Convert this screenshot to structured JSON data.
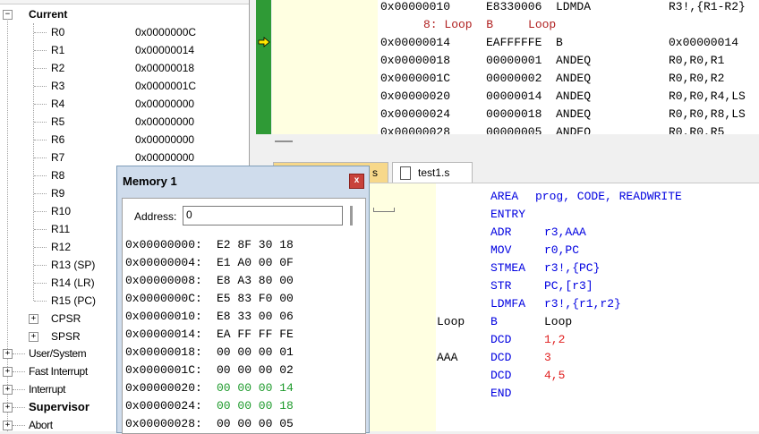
{
  "registers": {
    "group_label": "Current",
    "rows": [
      {
        "name": "R0",
        "value": "0x0000000C"
      },
      {
        "name": "R1",
        "value": "0x00000014"
      },
      {
        "name": "R2",
        "value": "0x00000018"
      },
      {
        "name": "R3",
        "value": "0x0000001C"
      },
      {
        "name": "R4",
        "value": "0x00000000"
      },
      {
        "name": "R5",
        "value": "0x00000000"
      },
      {
        "name": "R6",
        "value": "0x00000000"
      },
      {
        "name": "R7",
        "value": "0x00000000"
      },
      {
        "name": "R8",
        "value": ""
      },
      {
        "name": "R9",
        "value": ""
      },
      {
        "name": "R10",
        "value": ""
      },
      {
        "name": "R11",
        "value": ""
      },
      {
        "name": "R12",
        "value": ""
      },
      {
        "name": "R13 (SP)",
        "value": ""
      },
      {
        "name": "R14 (LR)",
        "value": ""
      },
      {
        "name": "R15 (PC)",
        "value": ""
      }
    ],
    "cpsr": "CPSR",
    "spsr": "SPSR",
    "modes": [
      "User/System",
      "Fast Interrupt",
      "Interrupt",
      "Supervisor",
      "Abort"
    ]
  },
  "disassembly": {
    "rows": [
      {
        "addr": "0x00000010",
        "op": "E8330006",
        "mn": "LDMDA",
        "args": "R3!,{R1-R2}"
      },
      {
        "addr": "",
        "op": "",
        "mn": "",
        "args": "",
        "source": "8: Loop  B     Loop"
      },
      {
        "addr": "0x00000014",
        "op": "EAFFFFFE",
        "mn": "B",
        "args": "0x00000014"
      },
      {
        "addr": "0x00000018",
        "op": "00000001",
        "mn": "ANDEQ",
        "args": "R0,R0,R1"
      },
      {
        "addr": "0x0000001C",
        "op": "00000002",
        "mn": "ANDEQ",
        "args": "R0,R0,R2"
      },
      {
        "addr": "0x00000020",
        "op": "00000014",
        "mn": "ANDEQ",
        "args": "R0,R0,R4,LS"
      },
      {
        "addr": "0x00000024",
        "op": "00000018",
        "mn": "ANDEQ",
        "args": "R0,R0,R8,LS"
      },
      {
        "addr": "0x00000028",
        "op": "00000005",
        "mn": "ANDEQ",
        "args": "R0,R0,R5"
      }
    ]
  },
  "tabs": [
    {
      "label": "s"
    },
    {
      "label": "test1.s"
    }
  ],
  "editor": {
    "lines": [
      {
        "label": "",
        "instr": "AREA",
        "ops": "prog, CODE, READWRITE"
      },
      {
        "label": "",
        "instr": "ENTRY",
        "ops": ""
      },
      {
        "label": "",
        "instr": "ADR",
        "ops": "r3,AAA"
      },
      {
        "label": "",
        "instr": "MOV",
        "ops": "r0,PC"
      },
      {
        "label": "",
        "instr": "STMEA",
        "ops": "r3!,{PC}"
      },
      {
        "label": "",
        "instr": "STR",
        "ops": "PC,[r3]"
      },
      {
        "label": "",
        "instr": "LDMFA",
        "ops": "r3!,{r1,r2}"
      },
      {
        "label": "Loop",
        "instr": "B",
        "ops": "Loop"
      },
      {
        "label": "",
        "instr": "DCD",
        "ops": "1,2"
      },
      {
        "label": "AAA",
        "instr": "DCD",
        "ops": "3"
      },
      {
        "label": "",
        "instr": "DCD",
        "ops": "4,5"
      },
      {
        "label": "",
        "instr": "END",
        "ops": ""
      }
    ]
  },
  "memory": {
    "title": "Memory 1",
    "close": "x",
    "address_label": "Address:",
    "address_value": "0",
    "rows": [
      {
        "addr": "0x00000000:",
        "bytes": "E2 8F 30 18",
        "hl": false
      },
      {
        "addr": "0x00000004:",
        "bytes": "E1 A0 00 0F",
        "hl": false
      },
      {
        "addr": "0x00000008:",
        "bytes": "E8 A3 80 00",
        "hl": false
      },
      {
        "addr": "0x0000000C:",
        "bytes": "E5 83 F0 00",
        "hl": false
      },
      {
        "addr": "0x00000010:",
        "bytes": "E8 33 00 06",
        "hl": false
      },
      {
        "addr": "0x00000014:",
        "bytes": "EA FF FF FE",
        "hl": false
      },
      {
        "addr": "0x00000018:",
        "bytes": "00 00 00 01",
        "hl": false
      },
      {
        "addr": "0x0000001C:",
        "bytes": "00 00 00 02",
        "hl": false
      },
      {
        "addr": "0x00000020:",
        "bytes": "00 00 00 14",
        "hl": true
      },
      {
        "addr": "0x00000024:",
        "bytes": "00 00 00 18",
        "hl": true
      },
      {
        "addr": "0x00000028:",
        "bytes": "00 00 00 05",
        "hl": false
      }
    ]
  },
  "colors": {
    "margin_yellow": "#ffffe1",
    "gutter_green": "#2f9a36",
    "keyword_blue": "#0000e0",
    "number_red": "#e02020",
    "changed_green": "#1d9a2b"
  }
}
